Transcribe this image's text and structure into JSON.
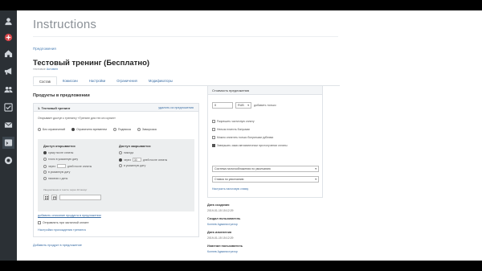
{
  "header": {
    "title": "Instructions"
  },
  "sidebar": {
    "icons": [
      "user-icon",
      "plus-icon",
      "home-icon",
      "megaphone-icon",
      "users-icon",
      "checkbox-icon",
      "mail-icon",
      "terminal-icon",
      "chat-icon"
    ]
  },
  "breadcrumb": "Предложения",
  "page": {
    "title": "Тестовый тренинг (Бесплатно)",
    "meta_prefix": "тестовое",
    "meta_link": "Активен"
  },
  "tabs": [
    {
      "label": "Состав",
      "active": true
    },
    {
      "label": "Комиссии",
      "active": false
    },
    {
      "label": "Настройки",
      "active": false
    },
    {
      "label": "Ограничения",
      "active": false
    },
    {
      "label": "Модификаторы",
      "active": false
    }
  ],
  "products": {
    "heading": "Продукты в предложении",
    "item": {
      "name": "1. Тестовый тренинг",
      "delete_label": "удалить из предложения",
      "access_text": "Открывает доступ к тренингу «Тренинг для тех кто купил»",
      "radios": [
        {
          "label": "Без ограничений",
          "selected": false
        },
        {
          "label": "Ограничено временем",
          "selected": true
        },
        {
          "label": "Подписка",
          "selected": false
        },
        {
          "label": "Заморозка",
          "selected": false
        }
      ],
      "access_open": {
        "title": "Доступ открывается",
        "options": [
          {
            "label": "сразу после оплаты",
            "selected": true
          },
          {
            "label": "точно в указанную дату",
            "selected": false
          },
          {
            "label": "через",
            "suffix": "дней после оплаты",
            "selected": false
          },
          {
            "label": "в указанную дату",
            "selected": false
          },
          {
            "label": "начиная с даты",
            "selected": false
          }
        ]
      },
      "access_close": {
        "title": "Доступ закрывается",
        "options": [
          {
            "label": "никогда",
            "selected": false
          },
          {
            "label": "через",
            "value": "30",
            "suffix": "дней после оплаты",
            "selected": true
          },
          {
            "label": "в указанную дату",
            "selected": false
          }
        ]
      },
      "schedule_label": "Уведомление в тексте через 10 минут",
      "add_description": "добавить описание продукта в предложении",
      "send_checkbox": {
        "label": "Отправлять при частичной оплате",
        "checked": false
      },
      "config_link": "Настройки прохождения тренинга"
    },
    "add_product": "Добавить продукт в предложение"
  },
  "cost": {
    "heading": "Стоимость предложения",
    "price": "0",
    "currency": "RUB",
    "add_price": "добавить только",
    "options": [
      {
        "label": "Разрешить частичную оплату",
        "checked": false
      },
      {
        "label": "Нельзя платить бонусами",
        "checked": false
      },
      {
        "label": "Можно оплатить только бонусными рублями",
        "checked": false
      },
      {
        "label": "Завершать заказ автоматически при получении оплаты",
        "checked": true
      }
    ],
    "tax_system": "Система налогообложения по умолчанию",
    "vat": "Ставка по умолчанию",
    "tax_hint": "Настроить налоговую ставку"
  },
  "info": {
    "created_label": "Дата создания",
    "created_value": "2019-01-15 15:12:29",
    "creator_label": "Создал пользователь",
    "creator_value": "Коннев Администратор",
    "modified_label": "Дата изменения",
    "modified_value": "2019-01-15 15:12:29",
    "modifier_label": "Изменил пользователь",
    "modifier_value": "Коннев Администратор"
  },
  "colors": {
    "sidebar": "#2b3035",
    "link": "#3b6ea5",
    "panel_head": "#f3f5f7",
    "access_box": "#eceeef"
  }
}
